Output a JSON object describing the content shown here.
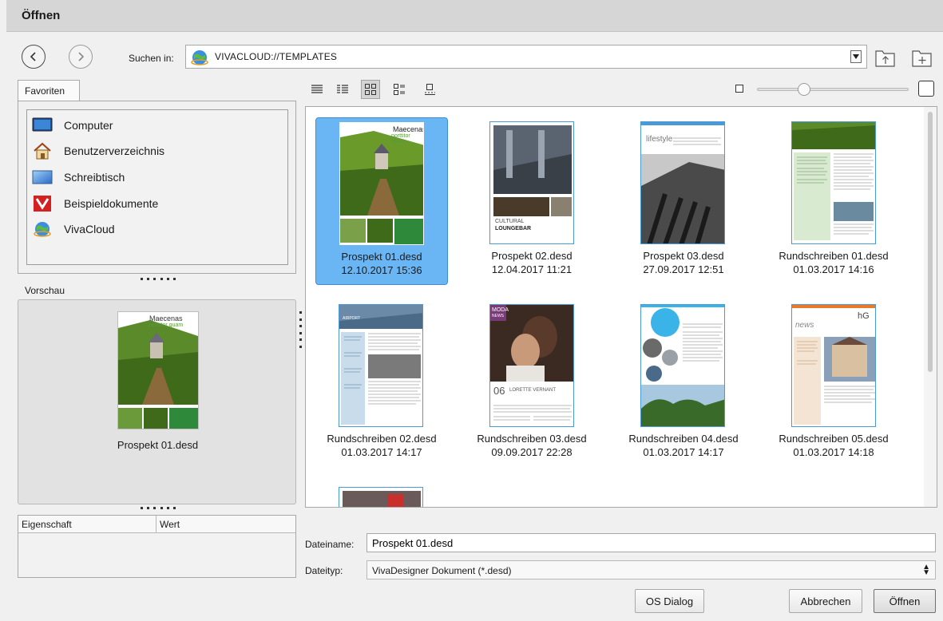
{
  "window": {
    "title": "Öffnen"
  },
  "nav": {
    "lookin_label": "Suchen in:",
    "path": "VIVACLOUD://TEMPLATES"
  },
  "favorites": {
    "tab_label": "Favoriten",
    "items": [
      {
        "label": "Computer",
        "icon": "monitor-icon"
      },
      {
        "label": "Benutzerverzeichnis",
        "icon": "home-icon"
      },
      {
        "label": "Schreibtisch",
        "icon": "desktop-icon"
      },
      {
        "label": "Beispieldokumente",
        "icon": "viva-logo-icon"
      },
      {
        "label": "VivaCloud",
        "icon": "cloud-globe-icon"
      }
    ]
  },
  "preview": {
    "label": "Vorschau",
    "file_name": "Prospekt 01.desd",
    "thumb_title": "Maecenas",
    "thumb_subtitle": "porttitor quam"
  },
  "properties": {
    "col_property": "Eigenschaft",
    "col_value": "Wert"
  },
  "files": [
    {
      "name": "Prospekt 01.desd",
      "date": "12.10.2017 15:36",
      "selected": true
    },
    {
      "name": "Prospekt 02.desd",
      "date": "12.04.2017 11:21",
      "selected": false
    },
    {
      "name": "Prospekt 03.desd",
      "date": "27.09.2017 12:51",
      "selected": false
    },
    {
      "name": "Rundschreiben 01.desd",
      "date": "01.03.2017 14:16",
      "selected": false
    },
    {
      "name": "Rundschreiben 02.desd",
      "date": "01.03.2017 14:17",
      "selected": false
    },
    {
      "name": "Rundschreiben 03.desd",
      "date": "09.09.2017 22:28",
      "selected": false
    },
    {
      "name": "Rundschreiben 04.desd",
      "date": "01.03.2017 14:17",
      "selected": false
    },
    {
      "name": "Rundschreiben 05.desd",
      "date": "01.03.2017 14:18",
      "selected": false
    }
  ],
  "thumb_text": {
    "p1_title": "Maecenas",
    "p1_sub": "porttitor quam",
    "p2_line1": "CULTURAL",
    "p2_line2": "LOUNGEBAR",
    "p3_title": "lifestyle",
    "r2_head": "AIRPORT",
    "r3_brand": "MODA",
    "r3_brand2": "NEWS",
    "r3_num": "06",
    "r3_caption": "LORETTE VERNANT",
    "r5_news": "news",
    "r5_logo": "hG"
  },
  "filename": {
    "label": "Dateiname:",
    "value": "Prospekt 01.desd"
  },
  "filetype": {
    "label": "Dateityp:",
    "value": "VivaDesigner Dokument (*.desd)"
  },
  "buttons": {
    "os_dialog": "OS Dialog",
    "cancel": "Abbrechen",
    "open": "Öffnen"
  },
  "colors": {
    "selection": "#6ab6f5",
    "thumb_border": "#4a9ad8",
    "accent_red": "#d42020"
  }
}
